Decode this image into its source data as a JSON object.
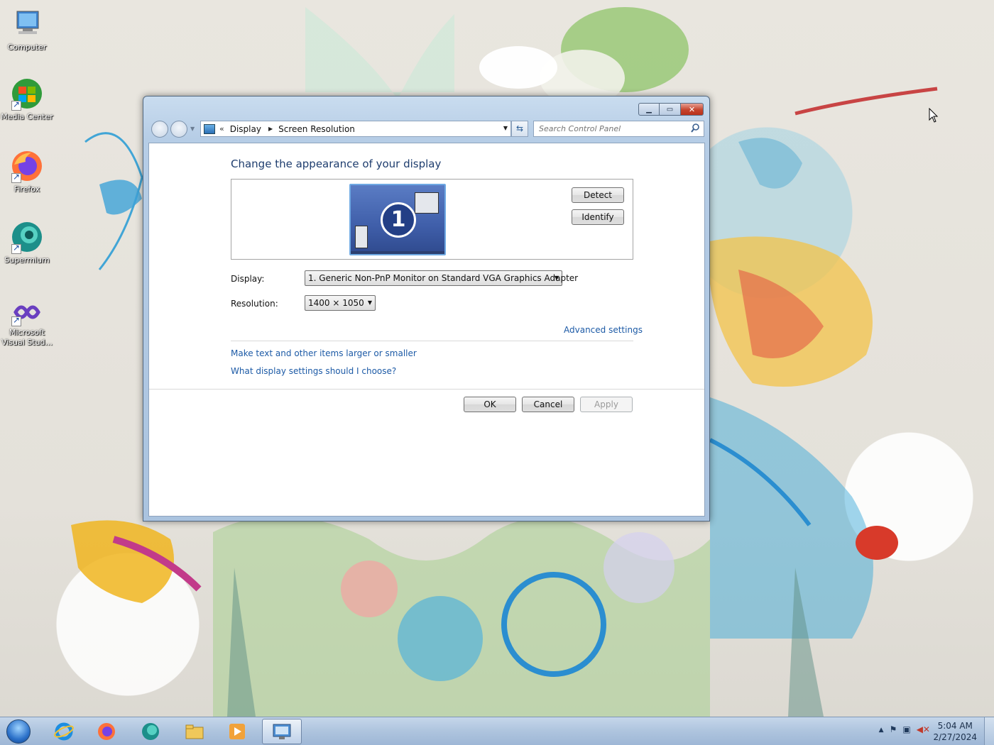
{
  "desktop": {
    "icons": [
      {
        "label": "Computer",
        "icon": "computer-icon"
      },
      {
        "label": "Media Center",
        "icon": "media-center-icon"
      },
      {
        "label": "Firefox",
        "icon": "firefox-icon"
      },
      {
        "label": "Supermium",
        "icon": "supermium-icon"
      },
      {
        "label": "Microsoft Visual Stud...",
        "icon": "visual-studio-icon"
      }
    ]
  },
  "window": {
    "address": {
      "overflow": "«",
      "crumb1": "Display",
      "crumb2": "Screen Resolution"
    },
    "search": {
      "placeholder": "Search Control Panel"
    },
    "heading": "Change the appearance of your display",
    "monitor_number": "1",
    "detect_label": "Detect",
    "identify_label": "Identify",
    "display_label": "Display:",
    "display_value": "1. Generic Non-PnP Monitor on Standard VGA Graphics Adapter",
    "resolution_label": "Resolution:",
    "resolution_value": "1400 × 1050",
    "advanced_link": "Advanced settings",
    "link_larger": "Make text and other items larger or smaller",
    "link_choose": "What display settings should I choose?",
    "ok_label": "OK",
    "cancel_label": "Cancel",
    "apply_label": "Apply"
  },
  "taskbar": {
    "items": [
      "start-orb",
      "internet-explorer-icon",
      "firefox-icon",
      "supermium-icon",
      "file-explorer-icon",
      "media-player-icon",
      "control-panel-icon"
    ],
    "time": "5:04 AM",
    "date": "2/27/2024",
    "tray_arrow": "▲"
  },
  "colors": {
    "link": "#1c5aa6",
    "heading": "#1e3d6e",
    "accent": "#3f5ea9"
  }
}
